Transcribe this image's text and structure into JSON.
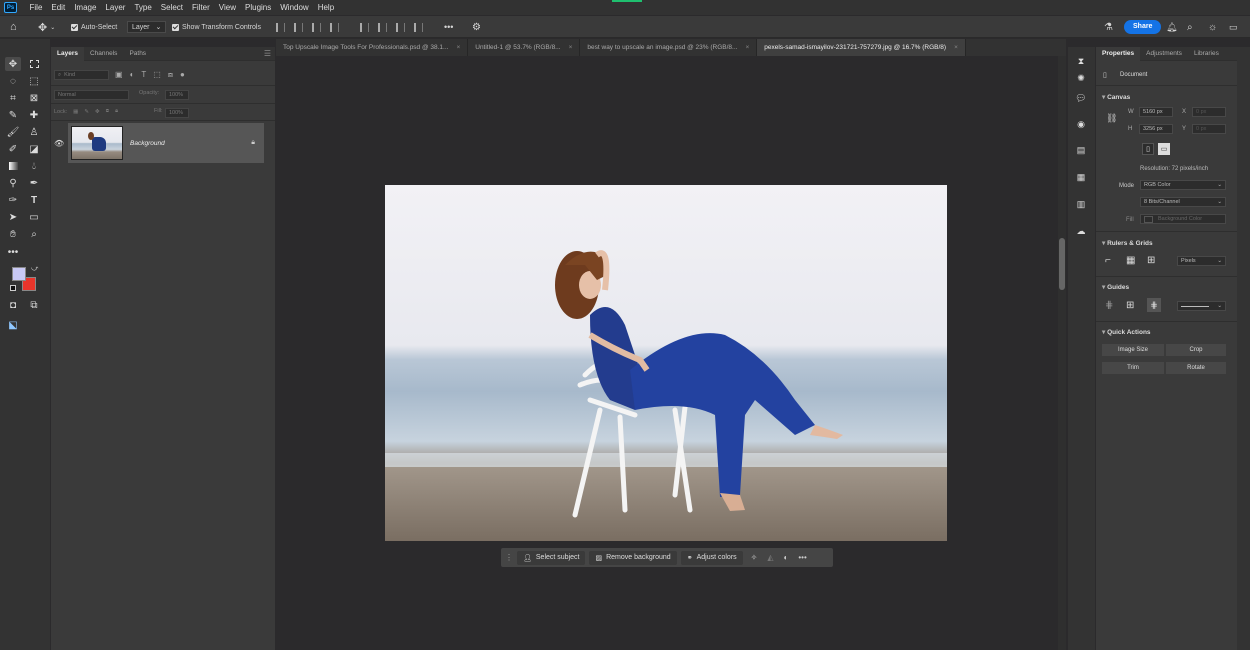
{
  "app": {
    "logo": "Ps",
    "accent_color": "#31a8ff",
    "brand_bg": "#001e36"
  },
  "menu": [
    "File",
    "Edit",
    "Image",
    "Layer",
    "Type",
    "Select",
    "Filter",
    "View",
    "Plugins",
    "Window",
    "Help"
  ],
  "options_bar": {
    "auto_select_label": "Auto-Select",
    "layer_select": "Layer",
    "transform_label": "Show Transform Controls",
    "more": "•••",
    "share_label": "Share",
    "share_color": "#1473e6"
  },
  "layers_panel": {
    "tabs": [
      "Layers",
      "Channels",
      "Paths"
    ],
    "kind_placeholder": "Kind",
    "blend_mode": "Normal",
    "opacity_label": "Opacity:",
    "opacity_value": "100%",
    "lock_label": "Lock:",
    "fill_label": "Fill:",
    "fill_value": "100%",
    "layer_name": "Background"
  },
  "doc_tabs": [
    {
      "title": "Top Upscale Image Tools For Professionals.psd @ 38.1...",
      "active": false
    },
    {
      "title": "Untitled-1 @ 53.7% (RGB/8...",
      "active": false
    },
    {
      "title": "best way to upscale an image.psd @ 23% (RGB/8...",
      "active": false
    },
    {
      "title": "pexels-samad-ismayilov-231721-757279.jpg @ 16.7% (RGB/8)",
      "active": true
    }
  ],
  "context_bar": {
    "select_subject": "Select subject",
    "remove_background": "Remove background",
    "adjust_colors": "Adjust colors",
    "more": "•••"
  },
  "properties": {
    "tabs": [
      "Properties",
      "Adjustments",
      "Libraries"
    ],
    "document_label": "Document",
    "canvas_title": "Canvas",
    "w_label": "W",
    "w_value": "5160 px",
    "h_label": "H",
    "h_value": "3256 px",
    "x_label": "X",
    "x_placeholder": "0 px",
    "y_label": "Y",
    "y_placeholder": "0 px",
    "resolution": "Resolution: 72 pixels/inch",
    "mode_label": "Mode",
    "mode_value": "RGB Color",
    "bits_value": "8 Bits/Channel",
    "fill_label": "Fill",
    "fill_value": "Background Color",
    "rulers_title": "Rulers & Grids",
    "units_value": "Pixels",
    "guides_title": "Guides",
    "quick_title": "Quick Actions",
    "image_size": "Image Size",
    "crop": "Crop",
    "trim": "Trim",
    "rotate": "Rotate"
  },
  "colors": {
    "foreground": "#c9c9f5",
    "background": "#e8352b"
  }
}
